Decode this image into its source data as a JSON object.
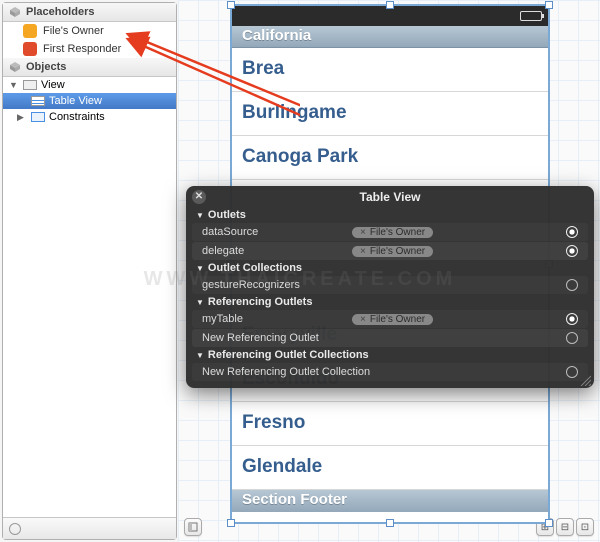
{
  "outline": {
    "placeholders_label": "Placeholders",
    "files_owner": "File's Owner",
    "first_responder": "First Responder",
    "objects_label": "Objects",
    "view": "View",
    "table_view": "Table View",
    "constraints": "Constraints"
  },
  "device": {
    "section_header": "California",
    "cells": [
      "Brea",
      "Burlingame",
      "Canoga Park",
      "Emeryville",
      "Escondido",
      "Fresno",
      "Glendale"
    ],
    "section_footer": "Section Footer"
  },
  "hud": {
    "title": "Table View",
    "groups": {
      "outlets": "Outlets",
      "outlet_collections": "Outlet Collections",
      "referencing_outlets": "Referencing Outlets",
      "referencing_outlet_collections": "Referencing Outlet Collections"
    },
    "rows": {
      "dataSource_name": "dataSource",
      "dataSource_dest": "File's Owner",
      "delegate_name": "delegate",
      "delegate_dest": "File's Owner",
      "gestureRecognizers_name": "gestureRecognizers",
      "myTable_name": "myTable",
      "myTable_dest": "File's Owner",
      "new_ref_outlet": "New Referencing Outlet",
      "new_ref_outlet_collection": "New Referencing Outlet Collection"
    }
  },
  "watermark": "WWW.THAICREATE.COM"
}
